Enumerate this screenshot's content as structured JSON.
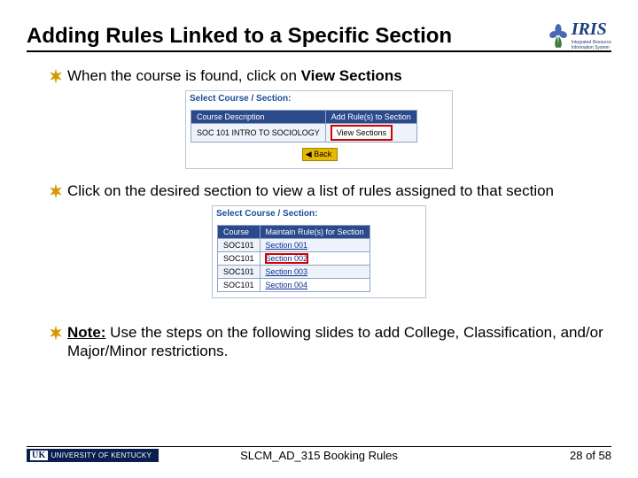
{
  "title": "Adding Rules Linked to a Specific Section",
  "logo": {
    "text": "IRIS",
    "sub1": "Integrated Resource",
    "sub2": "Information System"
  },
  "b1": {
    "pre": "When the course is found, click on ",
    "strong": "View Sections"
  },
  "shot1": {
    "title": "Select Course / Section:",
    "h1": "Course Description",
    "h2": "Add Rule(s) to Section",
    "course": "SOC 101 INTRO TO SOCIOLOGY",
    "btn": "View Sections",
    "back": "Back"
  },
  "b2": "Click on the desired section to view a list of rules assigned to that section",
  "shot2": {
    "title": "Select Course / Section:",
    "h1": "Course",
    "h2": "Maintain Rule(s) for Section",
    "rows": [
      {
        "c": "SOC101",
        "s": "Section 001"
      },
      {
        "c": "SOC101",
        "s": "Section 002"
      },
      {
        "c": "SOC101",
        "s": "Section 003"
      },
      {
        "c": "SOC101",
        "s": "Section 004"
      }
    ]
  },
  "b3": {
    "label": "Note:",
    "text": " Use the steps on the following slides to add College, Classification, and/or Major/Minor restrictions."
  },
  "footer": {
    "uk_mark": "UK",
    "uk_text": "UNIVERSITY OF KENTUCKY",
    "center": "SLCM_AD_315 Booking Rules",
    "right": "28 of 58"
  }
}
